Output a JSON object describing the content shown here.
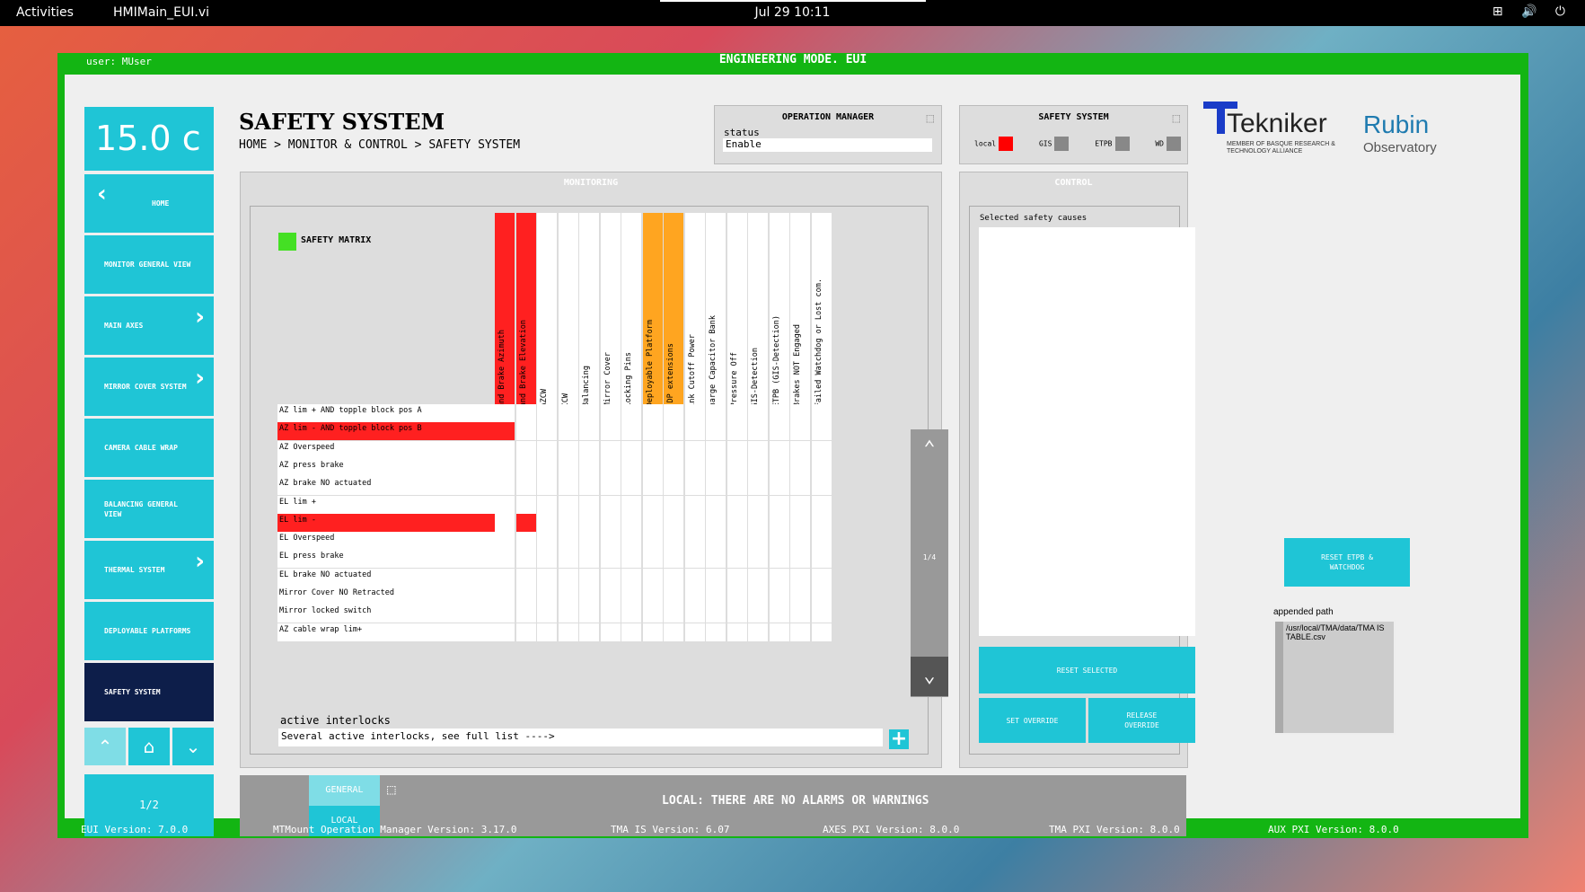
{
  "topbar": {
    "activities": "Activities",
    "app": "HMIMain_EUI.vi",
    "clock": "Jul 29  10:11",
    "tray": "⊞ 🔊 ⏻"
  },
  "header": {
    "user": "user: MUser",
    "mode": "ENGINEERING MODE. EUI"
  },
  "temperature": "15.0 c",
  "nav": [
    {
      "label": "HOME",
      "active": false
    },
    {
      "label": "MONITOR GENERAL VIEW",
      "active": false
    },
    {
      "label": "MAIN AXES",
      "active": false
    },
    {
      "label": "MIRROR COVER SYSTEM",
      "active": false
    },
    {
      "label": "CAMERA CABLE WRAP",
      "active": false
    },
    {
      "label": "BALANCING GENERAL VIEW",
      "active": false
    },
    {
      "label": "THERMAL SYSTEM",
      "active": false
    },
    {
      "label": "DEPLOYABLE PLATFORMS",
      "active": false
    },
    {
      "label": "SAFETY SYSTEM",
      "active": true
    }
  ],
  "nav_page": "1/2",
  "page_title": "SAFETY SYSTEM",
  "breadcrumb": "HOME > MONITOR & CONTROL > SAFETY SYSTEM",
  "op_manager": {
    "title": "OPERATION MANAGER",
    "status_label": "status",
    "status_value": "Enable"
  },
  "safety_status": {
    "title": "SAFETY SYSTEM",
    "indicators": [
      {
        "label": "local",
        "color": "#ff0000"
      },
      {
        "label": "GIS",
        "color": "#888888"
      },
      {
        "label": "ETPB",
        "color": "#888888"
      },
      {
        "label": "WD",
        "color": "#888888"
      }
    ]
  },
  "logos": {
    "tekniker": "Tekniker",
    "tekniker_sub": "MEMBER OF BASQUE RESEARCH & TECHNOLOGY ALLIANCE",
    "rubin": "Rubin",
    "rubin_sub": "Observatory"
  },
  "monitoring": {
    "title": "MONITORING",
    "matrix_title": "SAFETY MATRIX",
    "columns": [
      {
        "label": "STO and Brake Azimuth",
        "color": "#ff2020"
      },
      {
        "label": "STO and Brake Elevation",
        "color": "#ff2020"
      },
      {
        "label": "STO AZCW",
        "color": ""
      },
      {
        "label": "STO CCW",
        "color": ""
      },
      {
        "label": "STO Balancing",
        "color": ""
      },
      {
        "label": "STO Mirror Cover",
        "color": ""
      },
      {
        "label": "STO Locking Pins",
        "color": ""
      },
      {
        "label": "STO Deployable Platform",
        "color": "#ffa520"
      },
      {
        "label": "Lock DP extensions",
        "color": "#ffa520"
      },
      {
        "label": "DC-link Cutoff Power",
        "color": ""
      },
      {
        "label": "Discharge Capacitor Bank",
        "color": ""
      },
      {
        "label": "GSS Pressure Off",
        "color": ""
      },
      {
        "label": "CCW GIS-Detection",
        "color": ""
      },
      {
        "label": "TMA ETPB (GIS-Detection)",
        "color": ""
      },
      {
        "label": "TMA Brakes NOT Engaged",
        "color": ""
      },
      {
        "label": "MCS Failed Watchdog or Lost com.",
        "color": ""
      }
    ],
    "rows": [
      {
        "label": "AZ lim + AND topple block pos A",
        "active": false,
        "cells": []
      },
      {
        "label": "AZ lim - AND topple block pos B",
        "active": true,
        "cells": [
          0
        ]
      },
      {
        "label": "AZ Overspeed",
        "active": false,
        "cells": []
      },
      {
        "label": "AZ press brake",
        "active": false,
        "cells": []
      },
      {
        "label": "AZ brake NO actuated",
        "active": false,
        "cells": []
      },
      {
        "label": "EL lim +",
        "active": false,
        "cells": []
      },
      {
        "label": "EL lim -",
        "active": true,
        "cells": [
          1
        ]
      },
      {
        "label": "EL Overspeed",
        "active": false,
        "cells": []
      },
      {
        "label": "EL press brake",
        "active": false,
        "cells": []
      },
      {
        "label": "EL brake NO actuated",
        "active": false,
        "cells": []
      },
      {
        "label": "Mirror Cover NO Retracted",
        "active": false,
        "cells": []
      },
      {
        "label": "Mirror locked switch",
        "active": false,
        "cells": []
      },
      {
        "label": "AZ cable wrap lim+",
        "active": false,
        "cells": []
      }
    ],
    "pager": "1/4",
    "interlocks_label": "active interlocks",
    "interlocks_value": "Several active interlocks, see full list ---->"
  },
  "control": {
    "title": "CONTROL",
    "causes_label": "Selected safety causes",
    "reset_selected": "RESET SELECTED",
    "set_override": "SET OVERRIDE",
    "release_override": "RELEASE OVERRIDE"
  },
  "reset_etpb": "RESET ETPB & WATCHDOG",
  "appended": {
    "label": "appended path",
    "value": "/usr/local/TMA/data/TMA IS TABLE.csv"
  },
  "alarms": {
    "tab_general": "GENERAL",
    "tab_local": "LOCAL",
    "message": "LOCAL: THERE ARE NO ALARMS OR WARNINGS"
  },
  "footer": [
    "EUI Version: 7.0.0",
    "MTMount Operation Manager Version: 3.17.0",
    "TMA IS Version: 6.07",
    "AXES PXI Version: 8.0.0",
    "TMA PXI Version: 8.0.0",
    "AUX PXI Version: 8.0.0"
  ],
  "colors": {
    "accent": "#1fc5d6",
    "frame": "#13b513",
    "alarm": "#ff2020"
  }
}
